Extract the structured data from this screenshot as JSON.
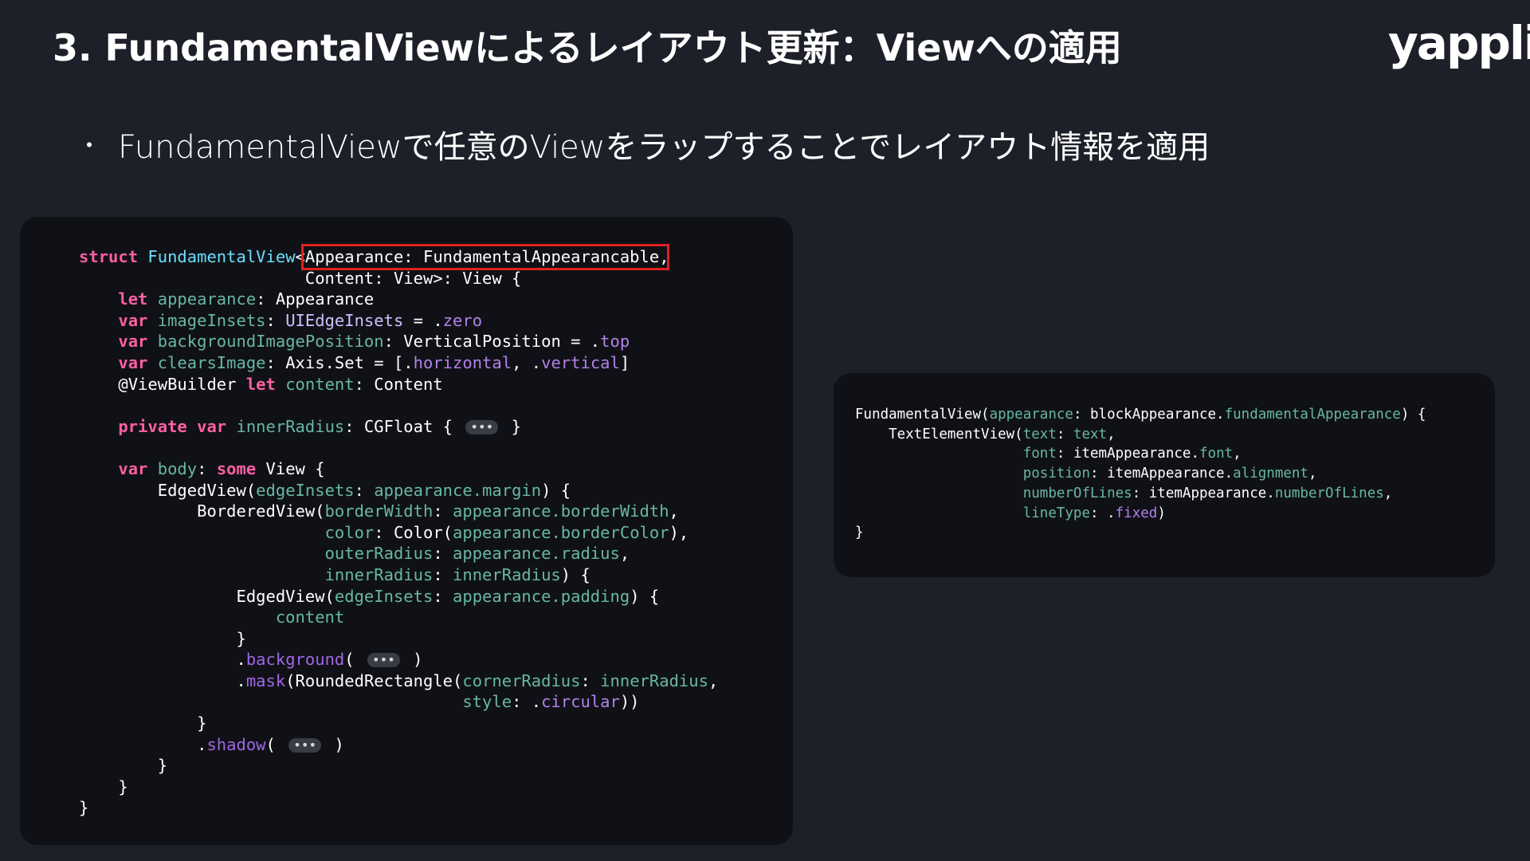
{
  "slide": {
    "title": "3. FundamentalViewによるレイアウト更新：Viewへの適用",
    "logo": "yappli",
    "bullet_marker": "・",
    "bullet_text": "FundamentalViewで任意のViewをラップすることでレイアウト情報を適用"
  },
  "colors": {
    "background": "#1d2029",
    "code_panel": "#101116",
    "keyword": "#fc5fa3",
    "type": "#6bdfff",
    "highlight_border": "#e02020"
  },
  "code_left": {
    "lines": [
      [
        [
          "kw",
          "struct "
        ],
        [
          "type",
          "FundamentalView"
        ],
        [
          "plain",
          "<Appearance: FundamentalAppearancable,"
        ]
      ],
      [
        [
          "plain",
          "                       Content: View>: View {"
        ]
      ],
      [
        [
          "plain",
          "    "
        ],
        [
          "kw",
          "let "
        ],
        [
          "id",
          "appearance"
        ],
        [
          "plain",
          ": Appearance"
        ]
      ],
      [
        [
          "plain",
          "    "
        ],
        [
          "kw",
          "var "
        ],
        [
          "id",
          "imageInsets"
        ],
        [
          "plain",
          ": "
        ],
        [
          "cls",
          "UIEdgeInsets"
        ],
        [
          "plain",
          " = ."
        ],
        [
          "enum",
          "zero"
        ]
      ],
      [
        [
          "plain",
          "    "
        ],
        [
          "kw",
          "var "
        ],
        [
          "id",
          "backgroundImagePosition"
        ],
        [
          "plain",
          ": VerticalPosition = ."
        ],
        [
          "enum",
          "top"
        ]
      ],
      [
        [
          "plain",
          "    "
        ],
        [
          "kw",
          "var "
        ],
        [
          "id",
          "clearsImage"
        ],
        [
          "plain",
          ": Axis.Set = [."
        ],
        [
          "enum",
          "horizontal"
        ],
        [
          "plain",
          ", ."
        ],
        [
          "enum",
          "vertical"
        ],
        [
          "plain",
          "]"
        ]
      ],
      [
        [
          "plain",
          "    @ViewBuilder "
        ],
        [
          "kw",
          "let "
        ],
        [
          "id",
          "content"
        ],
        [
          "plain",
          ": Content"
        ]
      ],
      [
        [
          "plain",
          ""
        ]
      ],
      [
        [
          "plain",
          "    "
        ],
        [
          "kw",
          "private var "
        ],
        [
          "id",
          "innerRadius"
        ],
        [
          "plain",
          ": CGFloat { "
        ],
        [
          "fold",
          "•••"
        ],
        [
          "plain",
          " }"
        ]
      ],
      [
        [
          "plain",
          ""
        ]
      ],
      [
        [
          "plain",
          "    "
        ],
        [
          "kw",
          "var "
        ],
        [
          "id",
          "body"
        ],
        [
          "plain",
          ": "
        ],
        [
          "kw",
          "some "
        ],
        [
          "plain",
          "View {"
        ]
      ],
      [
        [
          "plain",
          "        EdgedView("
        ],
        [
          "lbl",
          "edgeInsets"
        ],
        [
          "plain",
          ": "
        ],
        [
          "prop",
          "appearance.margin"
        ],
        [
          "plain",
          ") {"
        ]
      ],
      [
        [
          "plain",
          "            BorderedView("
        ],
        [
          "lbl",
          "borderWidth"
        ],
        [
          "plain",
          ": "
        ],
        [
          "prop",
          "appearance.borderWidth"
        ],
        [
          "plain",
          ","
        ]
      ],
      [
        [
          "plain",
          "                         "
        ],
        [
          "lbl",
          "color"
        ],
        [
          "plain",
          ": Color("
        ],
        [
          "prop",
          "appearance.borderColor"
        ],
        [
          "plain",
          "),"
        ]
      ],
      [
        [
          "plain",
          "                         "
        ],
        [
          "lbl",
          "outerRadius"
        ],
        [
          "plain",
          ": "
        ],
        [
          "prop",
          "appearance.radius"
        ],
        [
          "plain",
          ","
        ]
      ],
      [
        [
          "plain",
          "                         "
        ],
        [
          "lbl",
          "innerRadius"
        ],
        [
          "plain",
          ": "
        ],
        [
          "prop",
          "innerRadius"
        ],
        [
          "plain",
          ") {"
        ]
      ],
      [
        [
          "plain",
          "                EdgedView("
        ],
        [
          "lbl",
          "edgeInsets"
        ],
        [
          "plain",
          ": "
        ],
        [
          "prop",
          "appearance.padding"
        ],
        [
          "plain",
          ") {"
        ]
      ],
      [
        [
          "plain",
          "                    "
        ],
        [
          "prop",
          "content"
        ]
      ],
      [
        [
          "plain",
          "                }"
        ]
      ],
      [
        [
          "plain",
          "                ."
        ],
        [
          "fn",
          "background"
        ],
        [
          "plain",
          "( "
        ],
        [
          "fold",
          "•••"
        ],
        [
          "plain",
          " )"
        ]
      ],
      [
        [
          "plain",
          "                ."
        ],
        [
          "fn",
          "mask"
        ],
        [
          "plain",
          "(RoundedRectangle("
        ],
        [
          "lbl",
          "cornerRadius"
        ],
        [
          "plain",
          ": "
        ],
        [
          "prop",
          "innerRadius"
        ],
        [
          "plain",
          ","
        ]
      ],
      [
        [
          "plain",
          "                                       "
        ],
        [
          "lbl",
          "style"
        ],
        [
          "plain",
          ": ."
        ],
        [
          "enum",
          "circular"
        ],
        [
          "plain",
          "))"
        ]
      ],
      [
        [
          "plain",
          "            }"
        ]
      ],
      [
        [
          "plain",
          "            ."
        ],
        [
          "fn",
          "shadow"
        ],
        [
          "plain",
          "( "
        ],
        [
          "fold",
          "•••"
        ],
        [
          "plain",
          " )"
        ]
      ],
      [
        [
          "plain",
          "        }"
        ]
      ],
      [
        [
          "plain",
          "    }"
        ]
      ],
      [
        [
          "plain",
          "}"
        ]
      ]
    ]
  },
  "code_right": {
    "lines": [
      [
        [
          "plain",
          "FundamentalView("
        ],
        [
          "lbl",
          "appearance"
        ],
        [
          "plain",
          ": blockAppearance."
        ],
        [
          "prop",
          "fundamentalAppearance"
        ],
        [
          "plain",
          ") {"
        ]
      ],
      [
        [
          "plain",
          "    TextElementView("
        ],
        [
          "lbl",
          "text"
        ],
        [
          "plain",
          ": "
        ],
        [
          "prop",
          "text"
        ],
        [
          "plain",
          ","
        ]
      ],
      [
        [
          "plain",
          "                    "
        ],
        [
          "lbl",
          "font"
        ],
        [
          "plain",
          ": itemAppearance."
        ],
        [
          "prop",
          "font"
        ],
        [
          "plain",
          ","
        ]
      ],
      [
        [
          "plain",
          "                    "
        ],
        [
          "lbl",
          "position"
        ],
        [
          "plain",
          ": itemAppearance."
        ],
        [
          "prop",
          "alignment"
        ],
        [
          "plain",
          ","
        ]
      ],
      [
        [
          "plain",
          "                    "
        ],
        [
          "lbl",
          "numberOfLines"
        ],
        [
          "plain",
          ": itemAppearance."
        ],
        [
          "prop",
          "numberOfLines"
        ],
        [
          "plain",
          ","
        ]
      ],
      [
        [
          "plain",
          "                    "
        ],
        [
          "lbl",
          "lineType"
        ],
        [
          "plain",
          ": ."
        ],
        [
          "enum",
          "fixed"
        ],
        [
          "plain",
          ")"
        ]
      ],
      [
        [
          "plain",
          "}"
        ]
      ]
    ]
  }
}
